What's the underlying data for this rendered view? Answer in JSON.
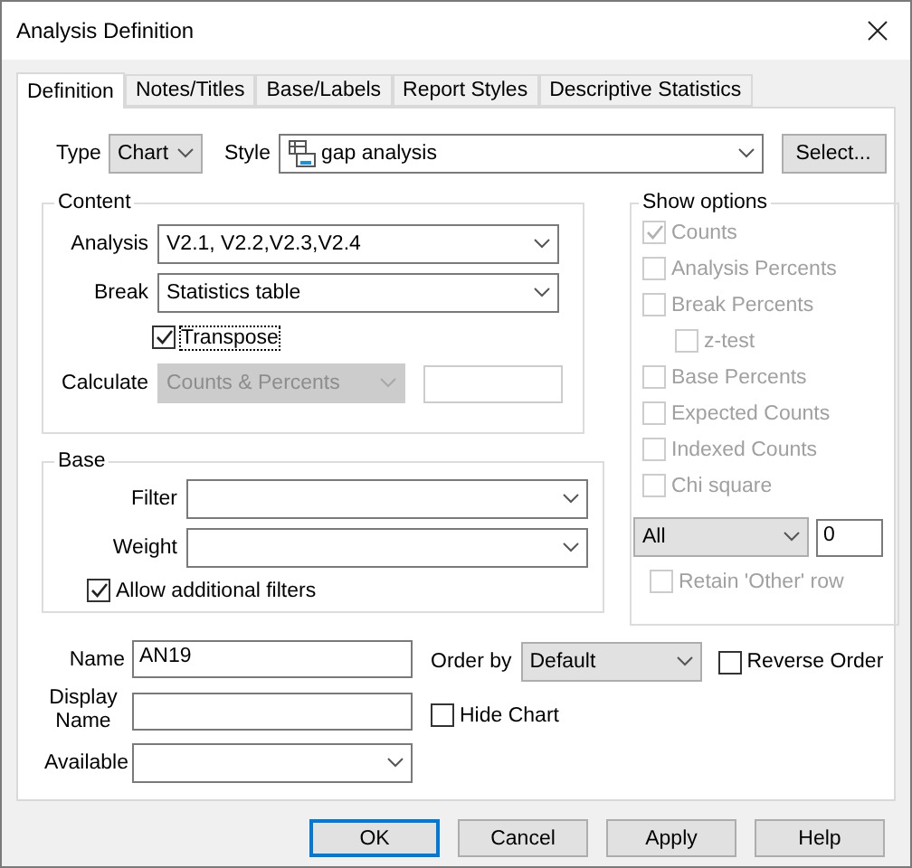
{
  "window": {
    "title": "Analysis Definition"
  },
  "tabs": [
    {
      "label": "Definition",
      "selected": true
    },
    {
      "label": "Notes/Titles",
      "selected": false
    },
    {
      "label": "Base/Labels",
      "selected": false
    },
    {
      "label": "Report Styles",
      "selected": false
    },
    {
      "label": "Descriptive Statistics",
      "selected": false
    }
  ],
  "type": {
    "label": "Type",
    "value": "Chart"
  },
  "style": {
    "label": "Style",
    "value": "gap analysis"
  },
  "select_button": "Select...",
  "content": {
    "title": "Content",
    "analysis": {
      "label": "Analysis",
      "value": "V2.1, V2.2,V2.3,V2.4"
    },
    "break": {
      "label": "Break",
      "value": "Statistics table"
    },
    "transpose": {
      "label": "Transpose",
      "checked": true
    },
    "calculate": {
      "label": "Calculate",
      "value": "Counts & Percents",
      "disabled": true
    }
  },
  "show_options": {
    "title": "Show options",
    "items": [
      {
        "label": "Counts",
        "checked": true,
        "disabled": true
      },
      {
        "label": "Analysis Percents",
        "checked": false,
        "disabled": true
      },
      {
        "label": "Break Percents",
        "checked": false,
        "disabled": true,
        "children": [
          {
            "label": "z-test",
            "checked": false,
            "disabled": true
          }
        ]
      },
      {
        "label": "Base Percents",
        "checked": false,
        "disabled": true
      },
      {
        "label": "Expected Counts",
        "checked": false,
        "disabled": true
      },
      {
        "label": "Indexed Counts",
        "checked": false,
        "disabled": true
      },
      {
        "label": "Chi square",
        "checked": false,
        "disabled": true
      }
    ],
    "scope": {
      "value": "All"
    },
    "count": {
      "value": "0"
    },
    "retain": {
      "label": "Retain 'Other' row",
      "checked": false,
      "disabled": true
    }
  },
  "base": {
    "title": "Base",
    "filter": {
      "label": "Filter"
    },
    "weight": {
      "label": "Weight"
    },
    "allow_filters": {
      "label": "Allow additional filters",
      "checked": true
    }
  },
  "name": {
    "label": "Name",
    "value": "AN19"
  },
  "display_name": {
    "label": "Display Name"
  },
  "available": {
    "label": "Available"
  },
  "order_by": {
    "label": "Order by",
    "value": "Default"
  },
  "reverse_order": {
    "label": "Reverse Order",
    "checked": false
  },
  "hide_chart": {
    "label": "Hide Chart",
    "checked": false
  },
  "buttons": [
    {
      "label": "OK",
      "default": true
    },
    {
      "label": "Cancel",
      "default": false
    },
    {
      "label": "Apply",
      "default": false
    },
    {
      "label": "Help",
      "default": false
    }
  ]
}
